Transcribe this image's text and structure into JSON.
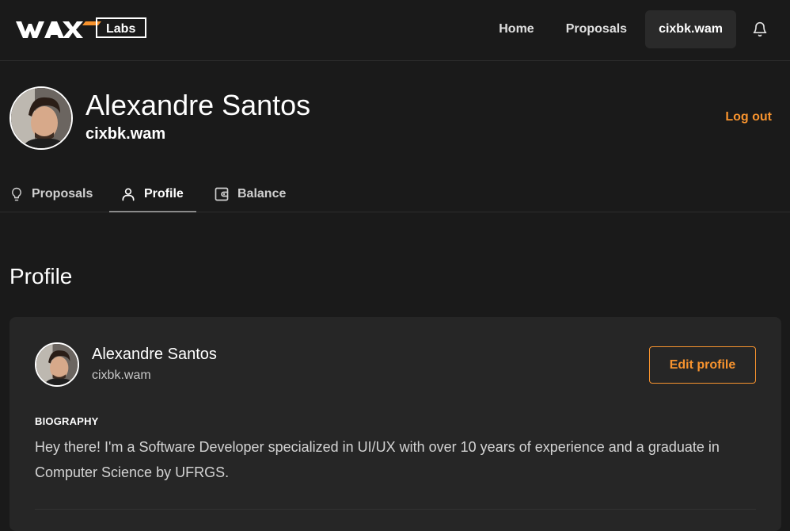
{
  "brand": {
    "logo_text": "Labs",
    "accent_color": "#f7932e"
  },
  "nav": {
    "items": [
      {
        "label": "Home"
      },
      {
        "label": "Proposals"
      },
      {
        "label": "cixbk.wam",
        "active": true
      }
    ],
    "icon": "bell-icon"
  },
  "header": {
    "name": "Alexandre Santos",
    "account": "cixbk.wam",
    "logout_label": "Log out"
  },
  "tabs": [
    {
      "label": "Proposals",
      "icon": "lightbulb-icon"
    },
    {
      "label": "Profile",
      "icon": "user-icon",
      "active": true
    },
    {
      "label": "Balance",
      "icon": "wallet-icon"
    }
  ],
  "section_title": "Profile",
  "card": {
    "name": "Alexandre Santos",
    "account": "cixbk.wam",
    "edit_label": "Edit profile",
    "bio_label": "BIOGRAPHY",
    "bio_text": "Hey there! I'm a Software Developer specialized in UI/UX with over 10 years of experience and a graduate in Computer Science by UFRGS."
  }
}
